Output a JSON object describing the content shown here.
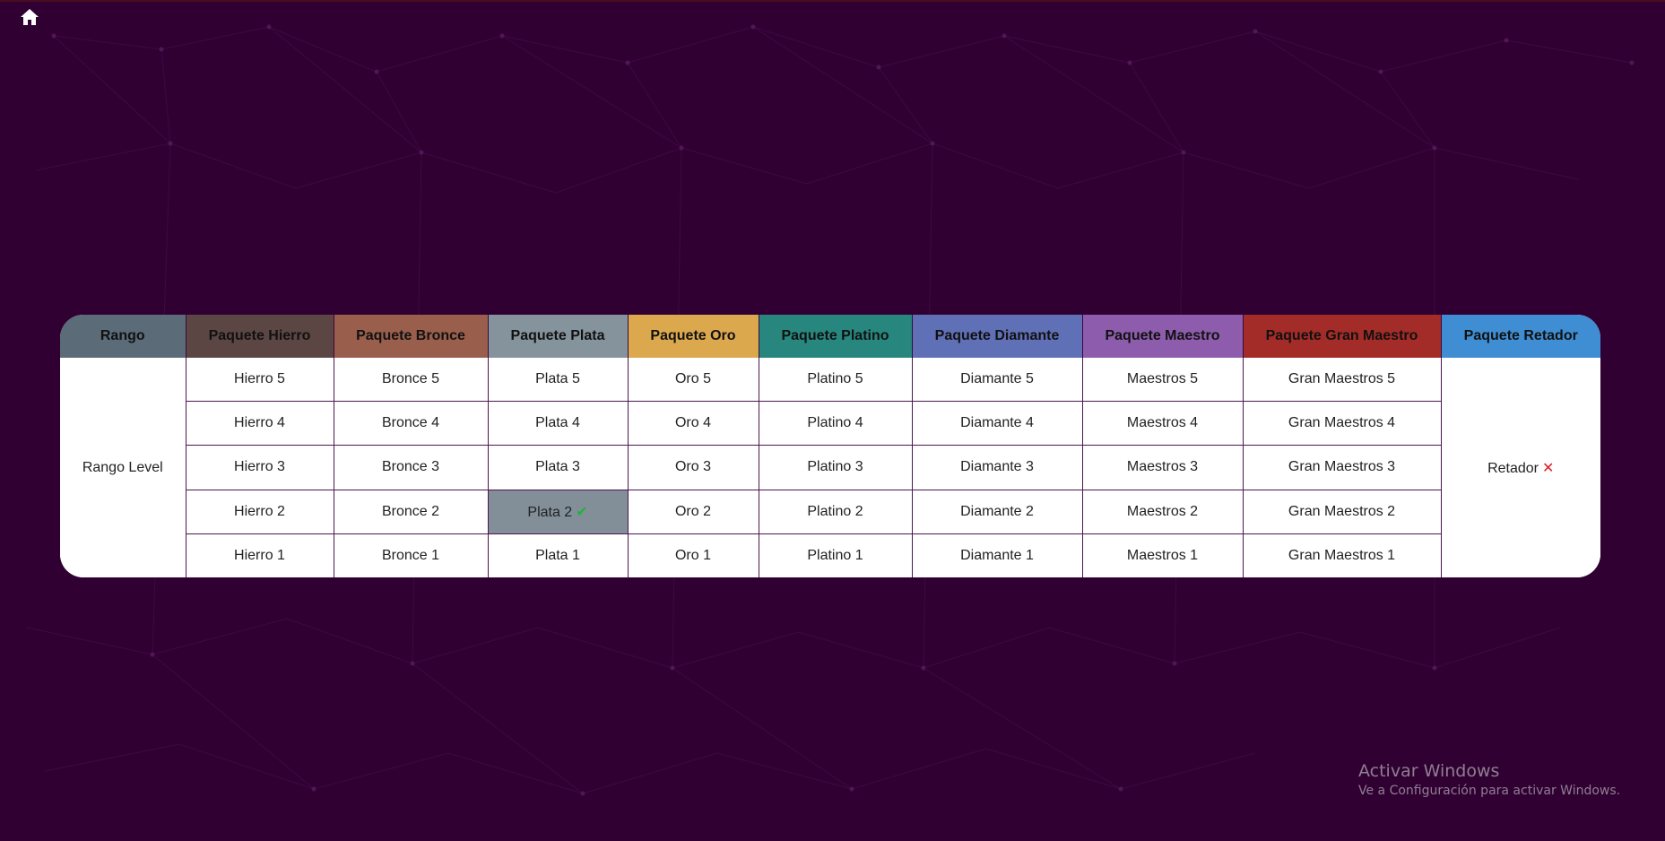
{
  "page": {
    "background_color": "#310033",
    "home_icon": "home-icon"
  },
  "table": {
    "headers": [
      {
        "label": "Rango",
        "color": "#5b6b77"
      },
      {
        "label": "Paquete Hierro",
        "color": "#5b4643"
      },
      {
        "label": "Paquete Bronce",
        "color": "#9a5f4c"
      },
      {
        "label": "Paquete Plata",
        "color": "#84939c"
      },
      {
        "label": "Paquete Oro",
        "color": "#dca84e"
      },
      {
        "label": "Paquete Platino",
        "color": "#27877e"
      },
      {
        "label": "Paquete Diamante",
        "color": "#5f70b7"
      },
      {
        "label": "Paquete Maestro",
        "color": "#8d5cac"
      },
      {
        "label": "Paquete Gran Maestro",
        "color": "#a32c28"
      },
      {
        "label": "Paquete Retador",
        "color": "#3f8ed3"
      }
    ],
    "rango_label": "Rango Level",
    "retador_label": "Retador",
    "retador_status_icon": "cross-icon",
    "current_status_icon": "check-icon",
    "current_highlight_color": "#828f99",
    "rows": [
      [
        "Hierro 5",
        "Bronce 5",
        "Plata 5",
        "Oro 5",
        "Platino 5",
        "Diamante 5",
        "Maestros 5",
        "Gran Maestros 5"
      ],
      [
        "Hierro 4",
        "Bronce 4",
        "Plata 4",
        "Oro 4",
        "Platino 4",
        "Diamante 4",
        "Maestros 4",
        "Gran Maestros 4"
      ],
      [
        "Hierro 3",
        "Bronce 3",
        "Plata 3",
        "Oro 3",
        "Platino 3",
        "Diamante 3",
        "Maestros 3",
        "Gran Maestros 3"
      ],
      [
        "Hierro 2",
        "Bronce 2",
        "Plata 2",
        "Oro 2",
        "Platino 2",
        "Diamante 2",
        "Maestros 2",
        "Gran Maestros 2"
      ],
      [
        "Hierro 1",
        "Bronce 1",
        "Plata 1",
        "Oro 1",
        "Platino 1",
        "Diamante 1",
        "Maestros 1",
        "Gran Maestros 1"
      ]
    ]
  },
  "watermark": {
    "title": "Activar Windows",
    "subtitle": "Ve a Configuración para activar Windows."
  }
}
